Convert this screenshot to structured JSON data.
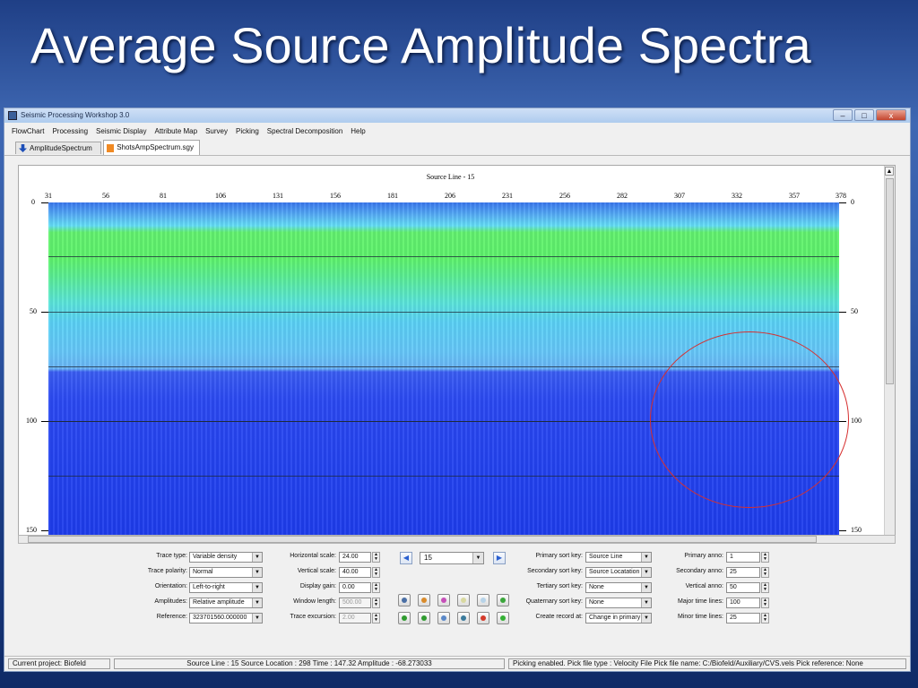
{
  "slide": {
    "title": "Average Source Amplitude Spectra"
  },
  "window": {
    "title": "Seismic Processing Workshop 3.0",
    "buttons": {
      "minimize": "–",
      "maximize": "□",
      "close": "x"
    }
  },
  "menu": [
    "FlowChart",
    "Processing",
    "Seismic Display",
    "Attribute Map",
    "Survey",
    "Picking",
    "Spectral Decomposition",
    "Help"
  ],
  "tabs": [
    {
      "label": "AmplitudeSpectrum",
      "icon": "arrow-down-icon",
      "active": false
    },
    {
      "label": "ShotsAmpSpectrum.sgy",
      "icon": "document-icon",
      "active": true
    }
  ],
  "plot": {
    "title": "Source Line - 15",
    "x_ticks": [
      "31",
      "56",
      "81",
      "106",
      "131",
      "156",
      "181",
      "206",
      "231",
      "256",
      "282",
      "307",
      "332",
      "357",
      "378"
    ],
    "y_ticks": [
      "0",
      "50",
      "100",
      "150"
    ],
    "colors": {
      "deep": "#1e3dec",
      "green": "#5ef46a",
      "cyan": "#64e0f6",
      "annotation": "#d63030"
    }
  },
  "controls": {
    "trace_type": {
      "label": "Trace type:",
      "value": "Variable density"
    },
    "trace_polarity": {
      "label": "Trace polarity:",
      "value": "Normal"
    },
    "orientation": {
      "label": "Orientation:",
      "value": "Left-to-right"
    },
    "amplitudes": {
      "label": "Amplitudes:",
      "value": "Relative amplitude"
    },
    "reference": {
      "label": "Reference:",
      "value": "323701560.000000"
    },
    "horizontal_scale": {
      "label": "Horizontal scale:",
      "value": "24.00"
    },
    "vertical_scale": {
      "label": "Vertical scale:",
      "value": "40.00"
    },
    "display_gain": {
      "label": "Display gain:",
      "value": "0.00"
    },
    "window_length": {
      "label": "Window length:",
      "value": "500.00"
    },
    "trace_excursion": {
      "label": "Trace excursion:",
      "value": "2.00"
    },
    "record_selector": {
      "value": "15",
      "prev": "◀",
      "next": "▶"
    },
    "primary_sort_key": {
      "label": "Primary sort key:",
      "value": "Source Line"
    },
    "secondary_sort_key": {
      "label": "Secondary sort key:",
      "value": "Source Locatation"
    },
    "tertiary_sort_key": {
      "label": "Tertiary sort key:",
      "value": "None"
    },
    "quaternary_sort_key": {
      "label": "Quaternary sort key:",
      "value": "None"
    },
    "create_record_at": {
      "label": "Create record at:",
      "value": "Change in primary"
    },
    "primary_anno": {
      "label": "Primary anno:",
      "value": "1"
    },
    "secondary_anno": {
      "label": "Secondary anno:",
      "value": "25"
    },
    "vertical_anno": {
      "label": "Vertical anno:",
      "value": "50"
    },
    "major_time_lines": {
      "label": "Major time lines:",
      "value": "100"
    },
    "minor_time_lines": {
      "label": "Minor time lines:",
      "value": "25"
    },
    "tool_icons": [
      "camera-icon",
      "palette-icon",
      "color-wheel-icon",
      "zoom-in-icon",
      "zoom-out-icon",
      "refresh-icon",
      "undo-icon",
      "redo-icon",
      "pan-icon",
      "globe-icon",
      "stop-icon",
      "go-icon"
    ]
  },
  "status": {
    "project": "Current project:  Biofeld",
    "cursor": "Source Line : 15   Source Location : 298   Time : 147.32   Amplitude : -68.273033",
    "picking": "Picking enabled.  Pick file type : Velocity File  Pick file name: C:/Biofeld/Auxiliary/CVS.vels  Pick reference: None"
  }
}
